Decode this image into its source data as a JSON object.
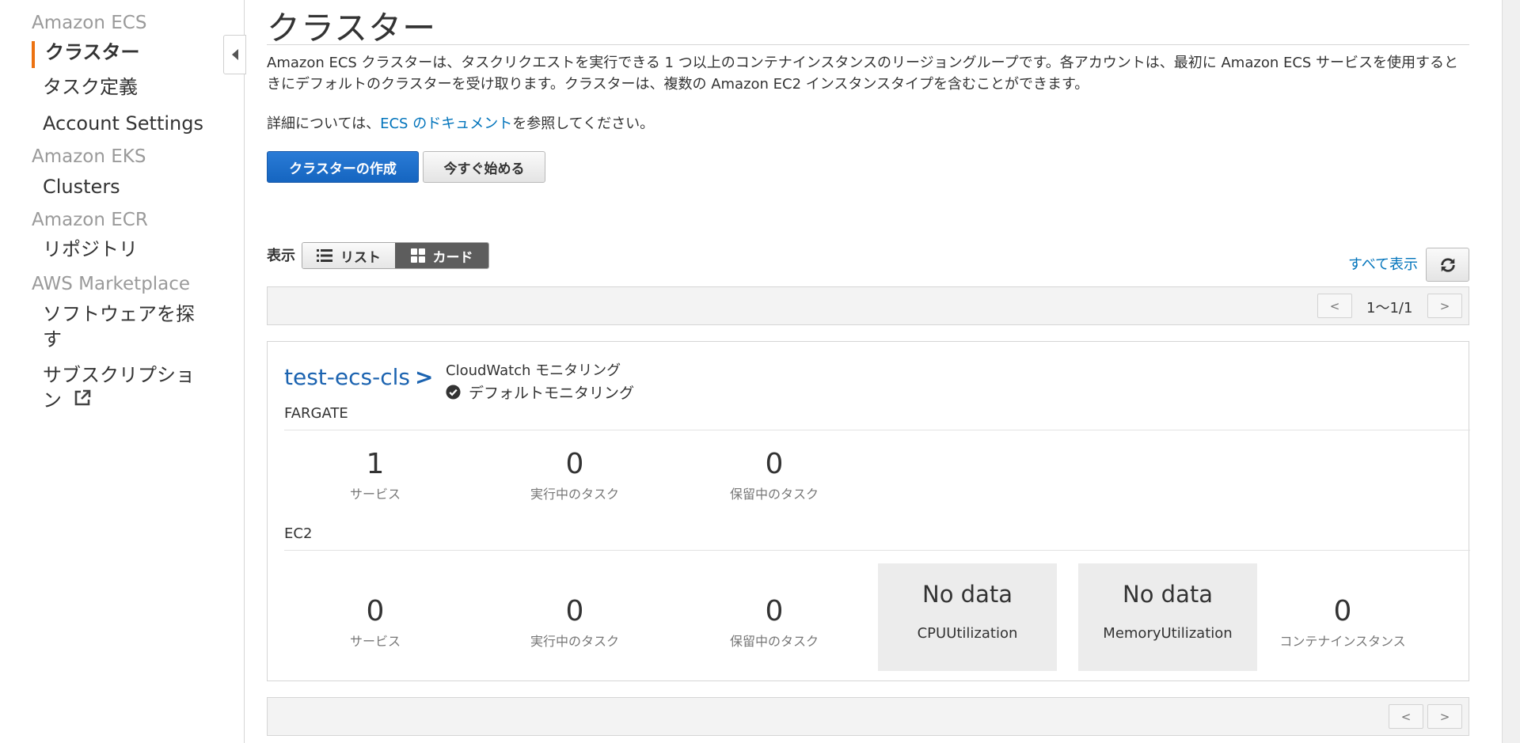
{
  "sidebar": {
    "groups": [
      {
        "title": "Amazon ECS"
      },
      {
        "title": "Amazon EKS"
      },
      {
        "title": "Amazon ECR"
      },
      {
        "title": "AWS Marketplace"
      }
    ],
    "items": {
      "clusters": "クラスター",
      "task_definitions": "タスク定義",
      "account_settings": "Account Settings",
      "eks_clusters": "Clusters",
      "repositories": "リポジトリ",
      "discover_software_line1": "ソフトウェアを探",
      "discover_software_line2": "す",
      "subscriptions_line1": "サブスクリプショ",
      "subscriptions_line2": "ン"
    },
    "accent_color": "#ec7211"
  },
  "main": {
    "title": "クラスター",
    "description": "Amazon ECS クラスターは、タスクリクエストを実行できる 1 つ以上のコンテナインスタンスのリージョングループです。各アカウントは、最初に Amazon ECS サービスを使用するときにデフォルトのクラスターを受け取ります。クラスターは、複数の Amazon EC2 インスタンスタイプを含むことができます。",
    "detail_prefix": "詳細については、",
    "detail_link": "ECS のドキュメント",
    "detail_suffix": "を参照してください。",
    "create_button": "クラスターの作成",
    "get_started_button": "今すぐ始める",
    "view_label": "表示",
    "view_list": "リスト",
    "view_card": "カード",
    "show_all": "すべて表示",
    "pagination": {
      "prev": "<",
      "next": ">",
      "range": "1〜1/1"
    }
  },
  "cluster_card": {
    "name": "test-ecs-cls",
    "arrow": ">",
    "cloudwatch_title": "CloudWatch モニタリング",
    "cloudwatch_status": "デフォルトモニタリング",
    "fargate": {
      "label": "FARGATE",
      "services": {
        "value": "1",
        "label": "サービス"
      },
      "running_tasks": {
        "value": "0",
        "label": "実行中のタスク"
      },
      "pending_tasks": {
        "value": "0",
        "label": "保留中のタスク"
      }
    },
    "ec2": {
      "label": "EC2",
      "services": {
        "value": "0",
        "label": "サービス"
      },
      "running_tasks": {
        "value": "0",
        "label": "実行中のタスク"
      },
      "pending_tasks": {
        "value": "0",
        "label": "保留中のタスク"
      },
      "cpu": {
        "value": "No data",
        "label": "CPUUtilization"
      },
      "memory": {
        "value": "No data",
        "label": "MemoryUtilization"
      },
      "container_instances": {
        "value": "0",
        "label": "コンテナインスタンス"
      }
    }
  },
  "icons": {
    "collapse": "caret-left-icon",
    "external_link": "external-link-icon",
    "list": "list-icon",
    "card": "grid-icon",
    "refresh": "refresh-icon",
    "check": "check-circle-icon"
  }
}
